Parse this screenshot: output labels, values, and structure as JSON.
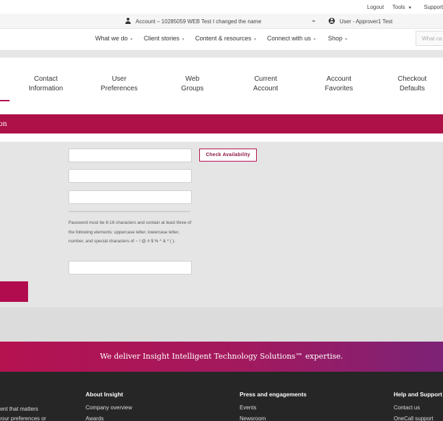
{
  "utility": {
    "logout": "Logout",
    "tools": "Tools",
    "support": "Support"
  },
  "account_bar": {
    "account": "Account – 10285059 WEB Test I changed the name",
    "user": "User - Approver1 Test"
  },
  "nav": {
    "items": [
      "What we do",
      "Client stories",
      "Content & resources",
      "Connect with us",
      "Shop"
    ],
    "search_placeholder": "What ca"
  },
  "tabs": [
    {
      "line1": "Contact",
      "line2": "Information"
    },
    {
      "line1": "User",
      "line2": "Preferences"
    },
    {
      "line1": "Web",
      "line2": "Groups"
    },
    {
      "line1": "Current",
      "line2": "Account"
    },
    {
      "line1": "Account",
      "line2": "Favorites"
    },
    {
      "line1": "Checkout",
      "line2": "Defaults"
    }
  ],
  "section_title": "on",
  "form": {
    "check_availability": "Check Availability",
    "password_help": "Password must be 8-16 characters and contain at least three of the following elements: uppercase letter, lowercase letter, number, and special characters of ~ ! @ # $ % ^ & * ( )."
  },
  "banner": {
    "text": "We deliver Insight Intelligent Technology Solutions™ expertise."
  },
  "footer": {
    "col1": {
      "line1": "tent that matters",
      "line2": "your preferences or"
    },
    "col2": {
      "title": "About Insight",
      "links": [
        "Company overview",
        "Awards"
      ]
    },
    "col3": {
      "title": "Press and engagements",
      "links": [
        "Events",
        "Newsroom"
      ]
    },
    "col4": {
      "title": "Help and Support",
      "links": [
        "Contact us",
        "OneCall support"
      ]
    }
  },
  "icons": {
    "account": "person-icon",
    "user": "user-circle-icon",
    "dropdown": "chevron-down-icon"
  },
  "colors": {
    "brand": "#ad1147",
    "footer": "#262626",
    "form_bg": "#e5e5e5"
  }
}
